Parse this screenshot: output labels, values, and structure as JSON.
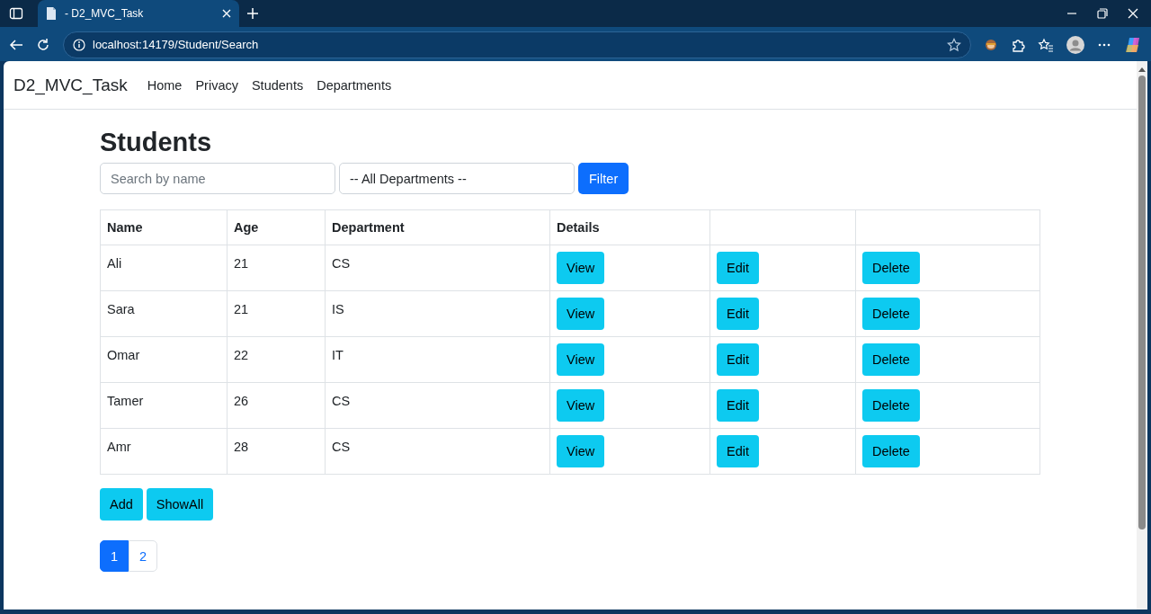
{
  "browser": {
    "tab_title": "- D2_MVC_Task",
    "url": "localhost:14179/Student/Search"
  },
  "navbar": {
    "brand": "D2_MVC_Task",
    "links": [
      "Home",
      "Privacy",
      "Students",
      "Departments"
    ]
  },
  "page": {
    "title": "Students",
    "search": {
      "placeholder": "Search by name"
    },
    "department_select": {
      "value": "-- All Departments --"
    },
    "filter_button": "Filter",
    "table": {
      "columns": [
        "Name",
        "Age",
        "Department",
        "Details"
      ],
      "rows": [
        {
          "name": "Ali",
          "age": "21",
          "department": "CS",
          "actions": [
            "View",
            "Edit",
            "Delete"
          ]
        },
        {
          "name": "Sara",
          "age": "21",
          "department": "IS",
          "actions": [
            "View",
            "Edit",
            "Delete"
          ]
        },
        {
          "name": "Omar",
          "age": "22",
          "department": "IT",
          "actions": [
            "View",
            "Edit",
            "Delete"
          ]
        },
        {
          "name": "Tamer",
          "age": "26",
          "department": "CS",
          "actions": [
            "View",
            "Edit",
            "Delete"
          ]
        },
        {
          "name": "Amr",
          "age": "28",
          "department": "CS",
          "actions": [
            "View",
            "Edit",
            "Delete"
          ]
        }
      ]
    },
    "buttons": [
      "Add",
      "ShowAll"
    ],
    "pagination": [
      {
        "label": "1",
        "selected": true
      },
      {
        "label": "2",
        "selected": false
      }
    ]
  }
}
